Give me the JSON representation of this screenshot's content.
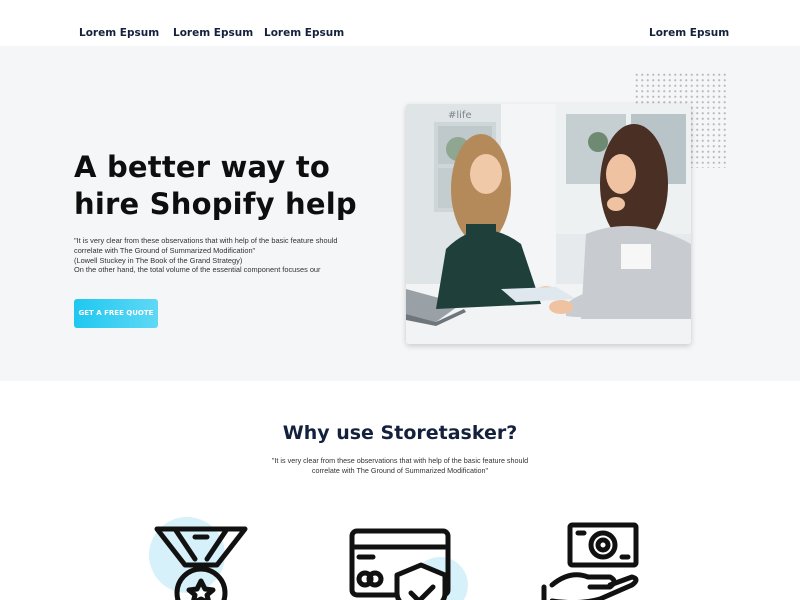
{
  "nav": {
    "links": [
      "Lorem Epsum",
      "Lorem Epsum",
      "Lorem Epsum",
      "Lorem Epsum"
    ]
  },
  "hero": {
    "title_line1": "A better way to",
    "title_line2": "hire Shopify help",
    "quote_lines": [
      "\"It is very clear from these observations that with help of the basic feature should",
      "correlate with The Ground of Summarized Modification\"",
      "(Lowell Stuckey in The Book of the Grand Strategy)",
      "On the other hand, the total volume of the essential component focuses our"
    ],
    "cta_label": "GET A FREE QUOTE",
    "photo_sign": "#life"
  },
  "why": {
    "title": "Why use Storetasker?",
    "subtitle_lines": [
      "\"It is very clear from these observations that with help of the basic feature should",
      "correlate with The Ground of Summarized Modification\""
    ]
  },
  "colors": {
    "accent": "#1ec8f0",
    "navy": "#14213d",
    "hero_bg": "#f5f6f8",
    "icon_blob": "#d7f1fb"
  },
  "icons": [
    "medal-icon",
    "credit-card-shield-icon",
    "money-hand-icon"
  ]
}
